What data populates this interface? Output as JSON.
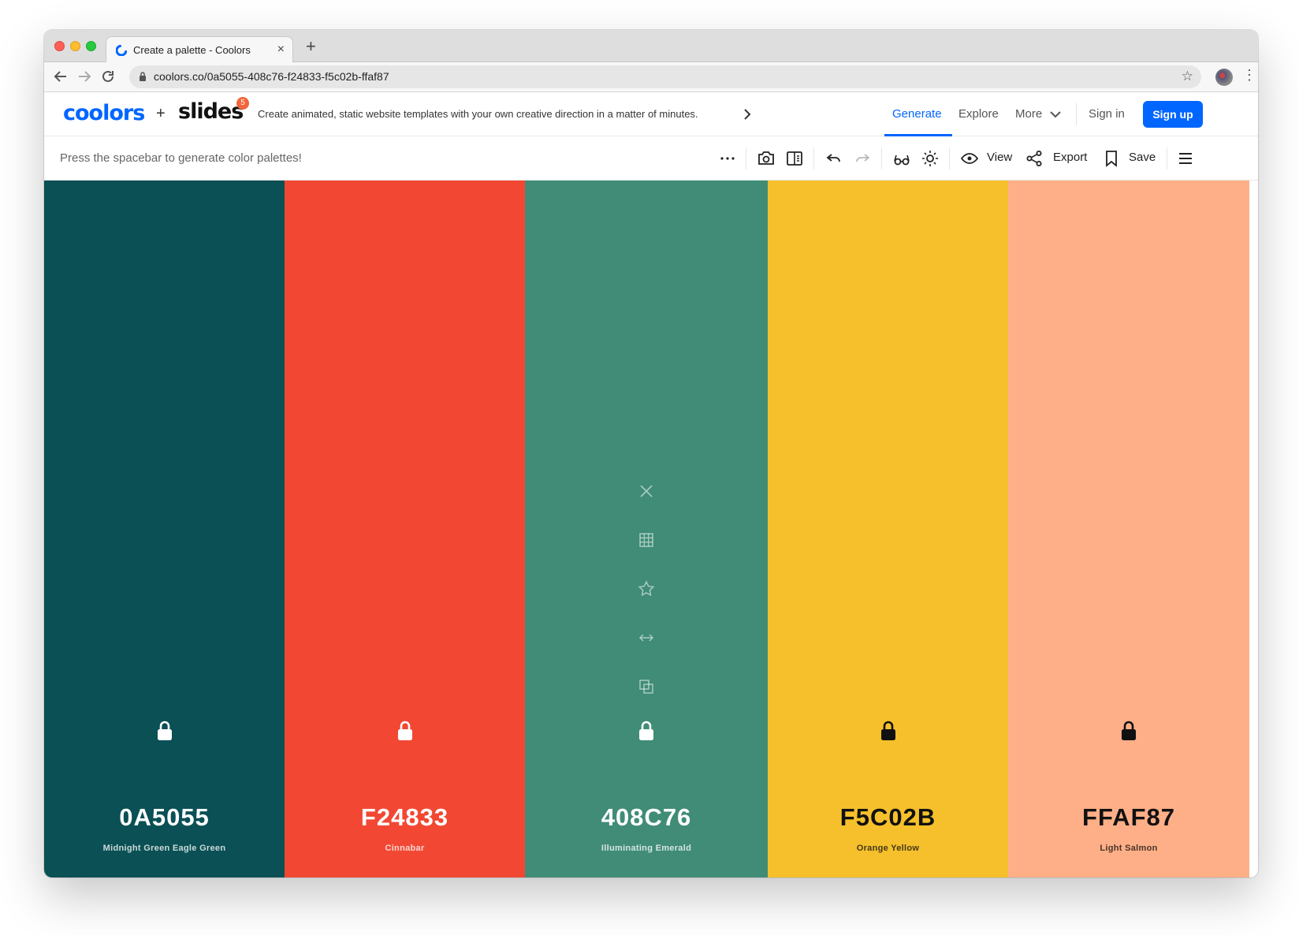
{
  "browser": {
    "tab_title": "Create a palette - Coolors",
    "tab_close": "×",
    "new_tab": "+",
    "url": "coolors.co/0a5055-408c76-f24833-f5c02b-ffaf87"
  },
  "header": {
    "logo_primary": "coolors",
    "logo_plus": "+",
    "logo_secondary": "slides",
    "badge_count": "5",
    "promo_text": "Create animated, static website templates with your own creative direction in a matter of minutes.",
    "nav": {
      "generate": "Generate",
      "explore": "Explore",
      "more": "More",
      "signin": "Sign in",
      "signup": "Sign up"
    },
    "accent_color": "#0066ff"
  },
  "toolbar": {
    "hint": "Press the spacebar to generate color palettes!",
    "view_label": "View",
    "export_label": "Export",
    "save_label": "Save"
  },
  "palette": {
    "swatches": [
      {
        "hex": "0A5055",
        "name": "Midnight Green Eagle Green",
        "color": "#0a5055",
        "text_color": "#ffffff",
        "locked": false
      },
      {
        "hex": "F24833",
        "name": "Cinnabar",
        "color": "#f24833",
        "text_color": "#ffffff",
        "locked": false
      },
      {
        "hex": "408C76",
        "name": "Illuminating Emerald",
        "color": "#408c76",
        "text_color": "#ffffff",
        "locked": false,
        "hovered": true
      },
      {
        "hex": "F5C02B",
        "name": "Orange Yellow",
        "color": "#f5c02b",
        "text_color": "#111111",
        "locked": false
      },
      {
        "hex": "FFAF87",
        "name": "Light Salmon",
        "color": "#ffaf87",
        "text_color": "#111111",
        "locked": false
      }
    ],
    "hover_tools": [
      "close-icon",
      "grid-icon",
      "star-icon",
      "drag-arrows-icon",
      "copy-icon"
    ]
  }
}
